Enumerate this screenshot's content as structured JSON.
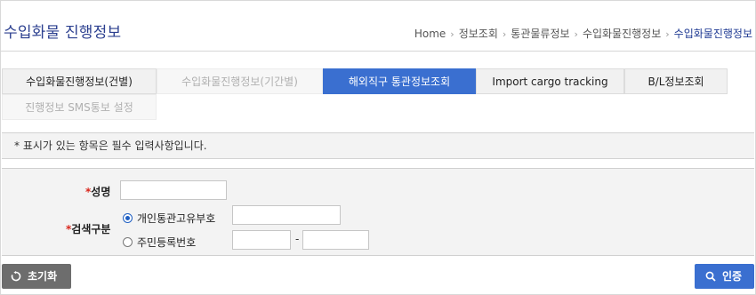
{
  "header": {
    "title": "수입화물 진행정보",
    "breadcrumb": [
      "Home",
      "정보조회",
      "통관물류정보",
      "수입화물진행정보",
      "수입화물진행정보"
    ]
  },
  "tabs": [
    {
      "label": "수입화물진행정보(건별)",
      "state": "normal"
    },
    {
      "label": "수입화물진행정보(기간별)",
      "state": "disabled"
    },
    {
      "label": "해외직구 통관정보조회",
      "state": "active"
    },
    {
      "label": "Import cargo tracking",
      "state": "normal"
    },
    {
      "label": "B/L정보조회",
      "state": "normal"
    },
    {
      "label": "진행정보 SMS통보 설정",
      "state": "disabled"
    }
  ],
  "notice": "* 표시가 있는 항목은 필수 입력사항입니다.",
  "form": {
    "name_label": "성명",
    "search_type_label": "검색구분",
    "required_mark": "*",
    "options": [
      {
        "label": "개인통관고유부호",
        "checked": true
      },
      {
        "label": "주민등록번호",
        "checked": false
      }
    ],
    "separator": "-"
  },
  "buttons": {
    "reset": "초기화",
    "auth": "인증"
  },
  "colors": {
    "accent": "#3a6fd0",
    "title": "#2b3f8f",
    "required": "#d9261c",
    "reset_button": "#6d6d6d"
  }
}
